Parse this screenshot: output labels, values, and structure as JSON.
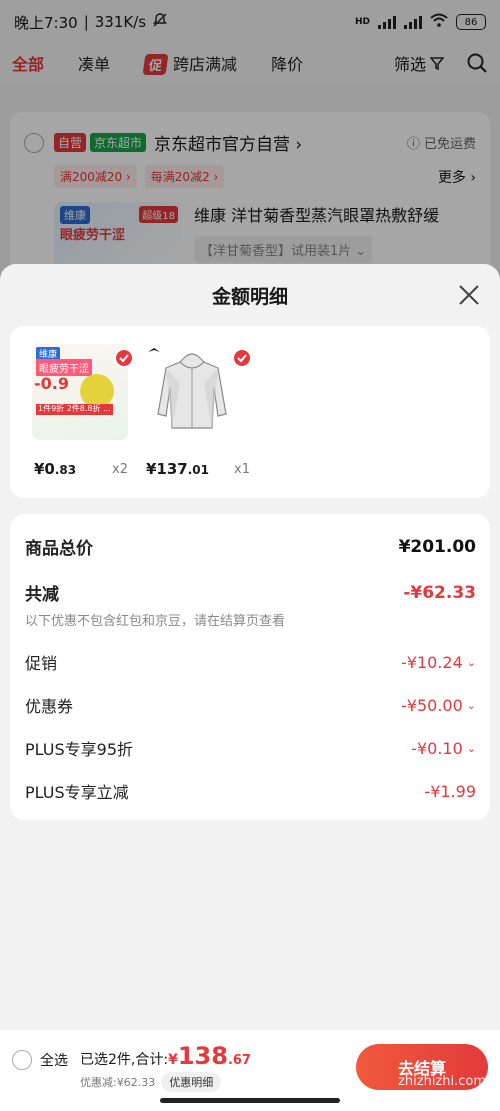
{
  "status": {
    "time": "晚上7:30",
    "speed": "331K/s",
    "hd": "HD",
    "battery": "86"
  },
  "tabs": [
    {
      "label": "全部"
    },
    {
      "label": "凑单"
    },
    {
      "label": "跨店满减",
      "tag": "促"
    },
    {
      "label": "降价"
    }
  ],
  "filter": {
    "label": "筛选"
  },
  "store": {
    "tag_self": "自营",
    "tag_super": "京东超市",
    "name": "京东超市官方自营 ›",
    "shipping": "ⓘ 已免运费",
    "coupons": [
      "满200减20 ›",
      "每满20减2 ›"
    ],
    "more": "更多 ›",
    "product_title": "维康 洋甘菊香型蒸汽眼罩热敷舒缓",
    "product_spec": "【洋甘菊香型】试用装1片 ⌄",
    "thumb_brand": "维康",
    "thumb_tag": "超级18",
    "thumb_text": "眼疲劳干涩"
  },
  "sheet": {
    "title": "金额明细",
    "items": [
      {
        "price_int": "¥0",
        "price_dec": ".83",
        "qty": "x2",
        "img": {
          "brand": "维康",
          "label": "眼疲劳干涩",
          "price": "-0.9",
          "promo": "1件9折 2件8.8折 ..."
        }
      },
      {
        "price_int": "¥137",
        "price_dec": ".01",
        "qty": "x1"
      }
    ],
    "summary": {
      "total_label": "商品总价",
      "total_value": "¥201.00",
      "discount_label": "共减",
      "discount_value": "-¥62.33",
      "note": "以下优惠不包含红包和京豆，请在结算页查看",
      "rows": [
        {
          "label": "促销",
          "value": "-¥10.24",
          "chevron": true
        },
        {
          "label": "优惠券",
          "value": "-¥50.00",
          "chevron": true
        },
        {
          "label": "PLUS专享95折",
          "value": "-¥0.10",
          "chevron": true
        },
        {
          "label": "PLUS专享立减",
          "value": "-¥1.99",
          "chevron": false
        }
      ]
    }
  },
  "bottom": {
    "select_all": "全选",
    "selected_text": "已选2件,合计:",
    "currency": "¥",
    "amount_int": "138",
    "amount_dec": ".67",
    "saved_text": "优惠减:¥62.33",
    "detail_button": "优惠明细",
    "checkout": "去结算",
    "watermark": "zhizhizhi.com"
  },
  "colors": {
    "accent": "#e4393c",
    "green": "#1aa34a"
  }
}
